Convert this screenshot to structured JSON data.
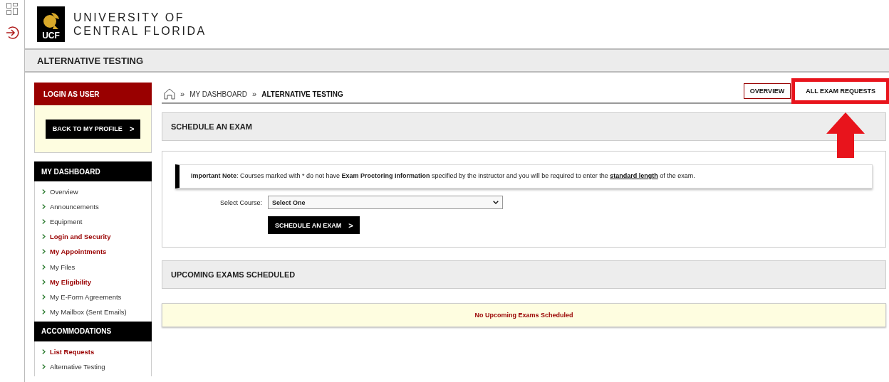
{
  "header": {
    "logo_mark": "UCF",
    "logo_text_lines": [
      "UNIVERSITY OF",
      "CENTRAL FLORIDA"
    ]
  },
  "page_title": "ALTERNATIVE TESTING",
  "sidebar": {
    "login_panel": {
      "title": "LOGIN AS USER",
      "button": "BACK TO MY PROFILE",
      "button_icon": ">"
    },
    "sections": [
      {
        "title": "MY DASHBOARD",
        "items": [
          {
            "label": "Overview",
            "emphasized": false
          },
          {
            "label": "Announcements",
            "emphasized": false
          },
          {
            "label": "Equipment",
            "emphasized": false
          },
          {
            "label": "Login and Security",
            "emphasized": true
          },
          {
            "label": "My Appointments",
            "emphasized": true
          },
          {
            "label": "My Files",
            "emphasized": false
          },
          {
            "label": "My Eligibility",
            "emphasized": true
          },
          {
            "label": "My E-Form Agreements",
            "emphasized": false
          },
          {
            "label": "My Mailbox (Sent Emails)",
            "emphasized": false
          }
        ]
      },
      {
        "title": "ACCOMMODATIONS",
        "items": [
          {
            "label": "List Requests",
            "emphasized": true
          },
          {
            "label": "Alternative Testing",
            "emphasized": false
          }
        ]
      }
    ]
  },
  "breadcrumb": {
    "separator": "»",
    "items": [
      {
        "label": "MY DASHBOARD",
        "current": false
      },
      {
        "label": "ALTERNATIVE TESTING",
        "current": true
      }
    ]
  },
  "tabs": [
    {
      "label": "OVERVIEW",
      "selected": true,
      "highlighted": false
    },
    {
      "label": "ALL EXAM REQUESTS",
      "selected": false,
      "highlighted": true
    }
  ],
  "schedule": {
    "title": "SCHEDULE AN EXAM",
    "note": "**Important Note**: Courses marked with * do not have **Exam Proctoring Information** specified by the instructor and you will be required to enter the ",
    "note_link": "standard length",
    "note_end": " of the exam.",
    "course_label": "Select Course:",
    "course_value": "Select One",
    "button": "SCHEDULE AN EXAM",
    "button_icon": ">"
  },
  "upcoming": {
    "title": "UPCOMING EXAMS SCHEDULED",
    "empty_message": "No Upcoming Exams Scheduled"
  }
}
